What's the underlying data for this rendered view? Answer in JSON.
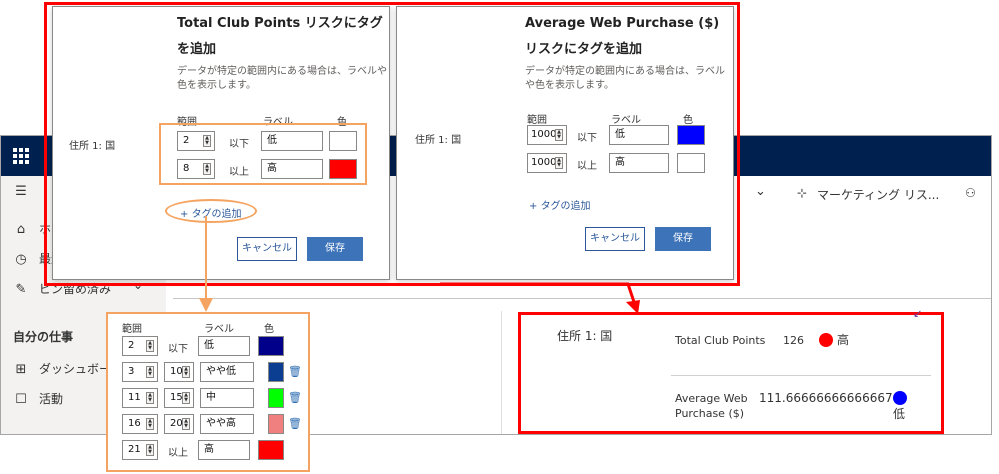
{
  "app": {
    "command_bar": {
      "marketing_label": "マーケティング リス...",
      "chevron": "chevron-down-icon"
    },
    "nav": {
      "items": [
        {
          "label": "ホーム",
          "icon": "home-icon"
        },
        {
          "label": "最近",
          "icon": "clock-icon"
        },
        {
          "label": "ピン留め済み",
          "icon": "pin-icon"
        }
      ],
      "section": "自分の仕事",
      "work_items": [
        {
          "label": "ダッシュボード",
          "icon": "dashboard-icon"
        },
        {
          "label": "活動",
          "icon": "clipboard-icon"
        }
      ]
    }
  },
  "dialog1": {
    "title": "Total Club Points リスクにタグを追加",
    "subtitle": "データが特定の範囲内にある場合は、ラベルや色を表示します。",
    "field_label": "住所 1: 国",
    "col_range": "範囲",
    "col_label": "ラベル",
    "col_color": "色",
    "rows": [
      {
        "value": "2",
        "op": "以下",
        "label": "低",
        "color": "#ffffff"
      },
      {
        "value": "8",
        "op": "以上",
        "label": "高",
        "color": "#ff0000"
      }
    ],
    "add_tag": "タグの追加",
    "cancel": "キャンセル",
    "save": "保存"
  },
  "dialog2": {
    "title": "Average Web Purchase ($) リスクにタグを追加",
    "subtitle": "データが特定の範囲内にある場合は、ラベルや色を表示します。",
    "field_label": "住所 1: 国",
    "col_range": "範囲",
    "col_label": "ラベル",
    "col_color": "色",
    "rows": [
      {
        "value": "1000",
        "op": "以下",
        "label": "低",
        "color": "#0000ff"
      },
      {
        "value": "1000",
        "op": "以上",
        "label": "高",
        "color": "#ffffff"
      }
    ],
    "add_tag": "タグの追加",
    "cancel": "キャンセル",
    "save": "保存"
  },
  "detail": {
    "col_range": "範囲",
    "col_label": "ラベル",
    "col_color": "色",
    "row1": {
      "value": "2",
      "op": "以下",
      "label": "低",
      "color": "#00008b"
    },
    "middle": [
      {
        "from": "3",
        "to": "10",
        "label": "やや低",
        "color": "#0b3d91"
      },
      {
        "from": "11",
        "to": "15",
        "label": "中",
        "color": "#00ff00"
      },
      {
        "from": "16",
        "to": "20",
        "label": "やや高",
        "color": "#f08080"
      }
    ],
    "last": {
      "value": "21",
      "op": "以上",
      "label": "高",
      "color": "#ff0000"
    }
  },
  "result": {
    "field_label": "住所 1: 国",
    "metric1_name": "Total Club Points",
    "metric1_value": "126",
    "metric1_tag": "高",
    "metric1_color": "#ff0000",
    "metric2_name_line1": "Average Web",
    "metric2_name_line2": "Purchase ($)",
    "metric2_value": "111.66666666666667",
    "metric2_tag": "低",
    "metric2_color": "#0000ff"
  }
}
